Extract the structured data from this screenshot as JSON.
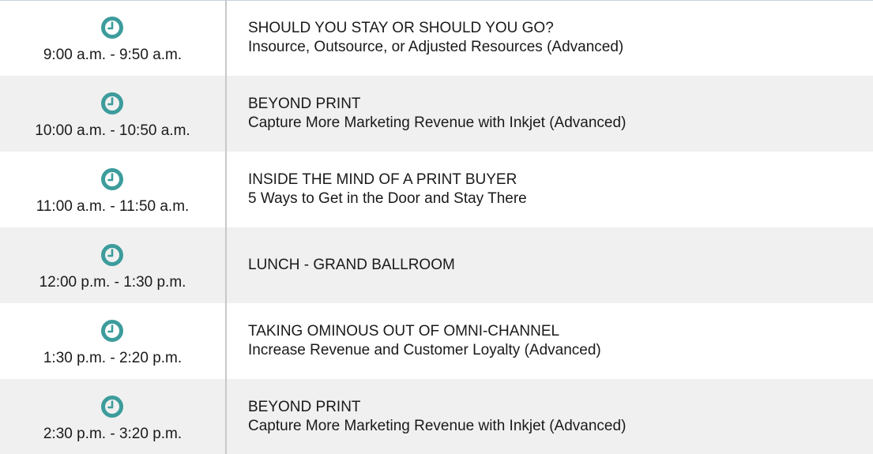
{
  "colors": {
    "clock_icon": "#3d9c9c",
    "row_shade": "#f0f0f0",
    "divider": "#c8c8c8"
  },
  "schedule": [
    {
      "time": "9:00 a.m. - 9:50 a.m.",
      "icon": "clock-icon",
      "title": "SHOULD YOU STAY OR SHOULD YOU GO?",
      "subtitle": "Insource, Outsource, or Adjusted Resources (Advanced)"
    },
    {
      "time": "10:00 a.m. - 10:50 a.m.",
      "icon": "clock-icon",
      "title": "BEYOND PRINT",
      "subtitle": "Capture More Marketing Revenue with Inkjet (Advanced)"
    },
    {
      "time": "11:00 a.m. - 11:50 a.m.",
      "icon": "clock-icon",
      "title": "INSIDE THE MIND OF A PRINT BUYER",
      "subtitle": "5 Ways to Get in the Door and Stay There"
    },
    {
      "time": "12:00 p.m. - 1:30 p.m.",
      "icon": "clock-icon",
      "title": "LUNCH - GRAND BALLROOM",
      "subtitle": ""
    },
    {
      "time": "1:30 p.m. - 2:20 p.m.",
      "icon": "clock-icon",
      "title": "TAKING OMINOUS OUT OF OMNI-CHANNEL",
      "subtitle": "Increase Revenue and Customer Loyalty (Advanced)"
    },
    {
      "time": "2:30 p.m. - 3:20 p.m.",
      "icon": "clock-icon",
      "title": "BEYOND PRINT",
      "subtitle": "Capture More Marketing Revenue with Inkjet (Advanced)"
    }
  ]
}
